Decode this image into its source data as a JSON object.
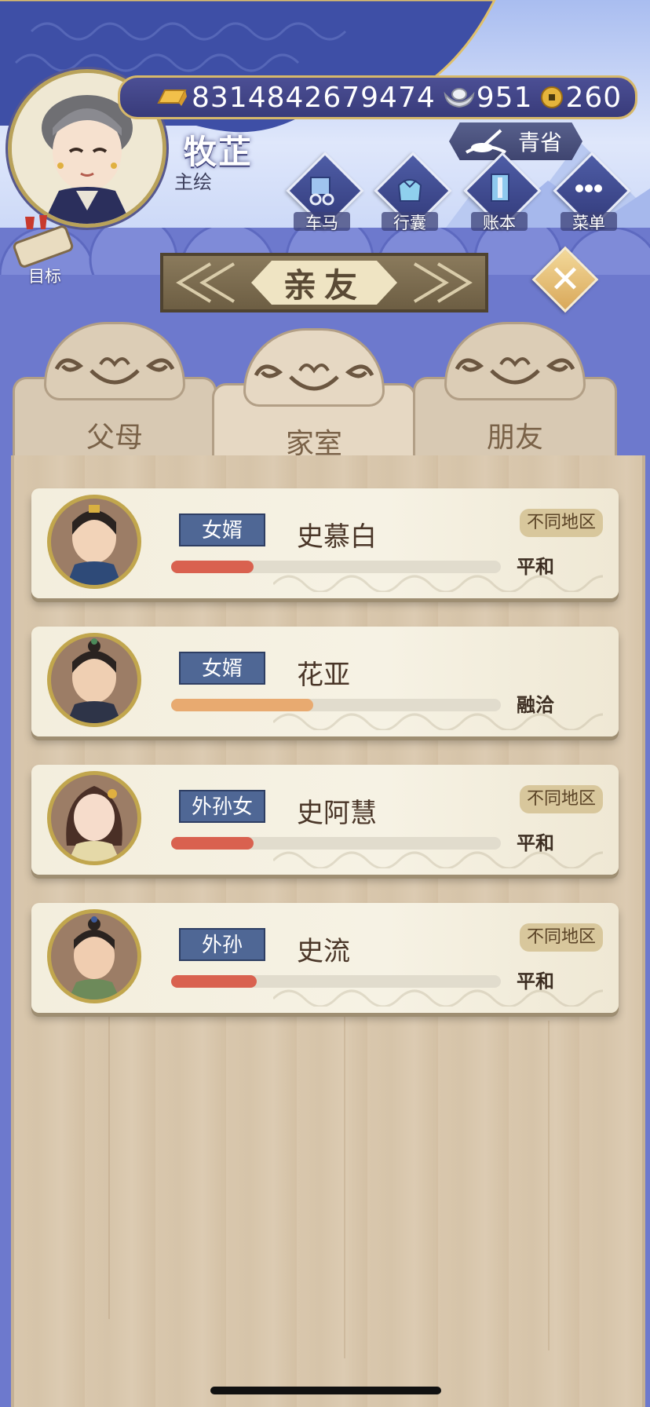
{
  "player": {
    "name": "牧芷",
    "title": "主绘"
  },
  "currency": {
    "gold": "8314842679474",
    "silver": "951",
    "coins": "260"
  },
  "region": "青省",
  "menu": [
    {
      "label": "车马",
      "icon": "carriage-icon"
    },
    {
      "label": "行囊",
      "icon": "bundle-icon"
    },
    {
      "label": "账本",
      "icon": "ledger-icon"
    },
    {
      "label": "菜单",
      "icon": "more-icon"
    }
  ],
  "goal": {
    "label": "目标",
    "icon": "scroll-icon"
  },
  "page_title": "亲友",
  "tabs": [
    {
      "label": "父母",
      "active": false
    },
    {
      "label": "家室",
      "active": true
    },
    {
      "label": "朋友",
      "active": false
    }
  ],
  "relatives": [
    {
      "relation": "女婿",
      "name": "史慕白",
      "region_tag": "不同地区",
      "mood": "平和",
      "affinity": 0.25,
      "bar_color": "#d9614f"
    },
    {
      "relation": "女婿",
      "name": "花亚",
      "region_tag": "",
      "mood": "融洽",
      "affinity": 0.43,
      "bar_color": "#e8aa70"
    },
    {
      "relation": "外孙女",
      "name": "史阿慧",
      "region_tag": "不同地区",
      "mood": "平和",
      "affinity": 0.25,
      "bar_color": "#d9614f"
    },
    {
      "relation": "外孙",
      "name": "史流",
      "region_tag": "不同地区",
      "mood": "平和",
      "affinity": 0.26,
      "bar_color": "#d9614f"
    }
  ],
  "colors": {
    "accent_blue": "#4f6795",
    "gold_border": "#c1a64d",
    "panel_wood": "#d9c7ad"
  }
}
